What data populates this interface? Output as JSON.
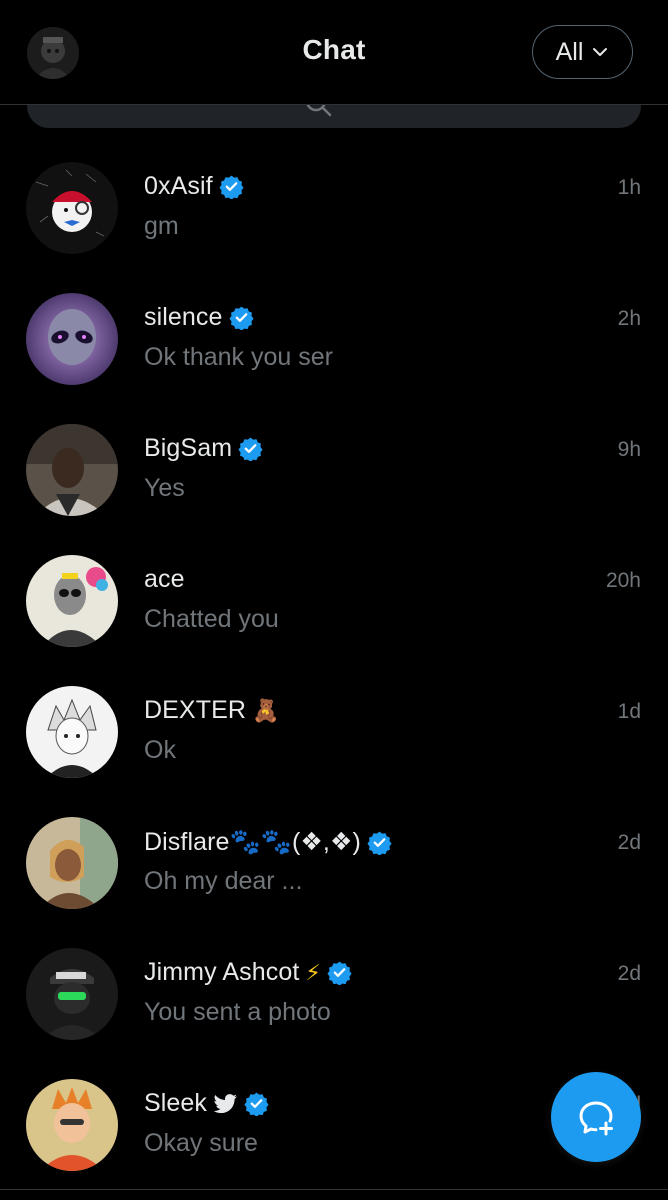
{
  "header": {
    "title": "Chat",
    "filter_label": "All",
    "avatar_icon": "profile-avatar",
    "filter_icon": "chevron-down-icon"
  },
  "search": {
    "icon": "search-icon"
  },
  "colors": {
    "background": "#000000",
    "primary_text": "#e7e9ea",
    "secondary_text": "#71767b",
    "accent": "#1d9bf0",
    "divider": "#2f3336"
  },
  "chats": [
    {
      "name": "0xAsif",
      "verified": true,
      "badge": "",
      "preview": "gm",
      "time": "1h"
    },
    {
      "name": "silence",
      "verified": true,
      "badge": "",
      "preview": "Ok thank you ser",
      "time": "2h"
    },
    {
      "name": "BigSam",
      "verified": true,
      "badge": "",
      "preview": "Yes",
      "time": "9h"
    },
    {
      "name": "ace",
      "verified": false,
      "badge": "",
      "preview": "Chatted you",
      "time": "20h"
    },
    {
      "name": "DEXTER",
      "verified": false,
      "badge": "🧸",
      "preview": "Ok",
      "time": "1d"
    },
    {
      "name": "Disflare🐾🐾(❖,❖)",
      "verified": true,
      "badge": "",
      "preview": "Oh my dear ...",
      "time": "2d"
    },
    {
      "name": "Jimmy Ashcot",
      "verified": true,
      "badge": "⚡",
      "preview": "You sent a photo",
      "time": "2d"
    },
    {
      "name": "Sleek",
      "verified": true,
      "badge": "bird-icon",
      "preview": "Okay sure",
      "time": "2d"
    }
  ],
  "fab": {
    "icon": "new-chat-icon"
  }
}
